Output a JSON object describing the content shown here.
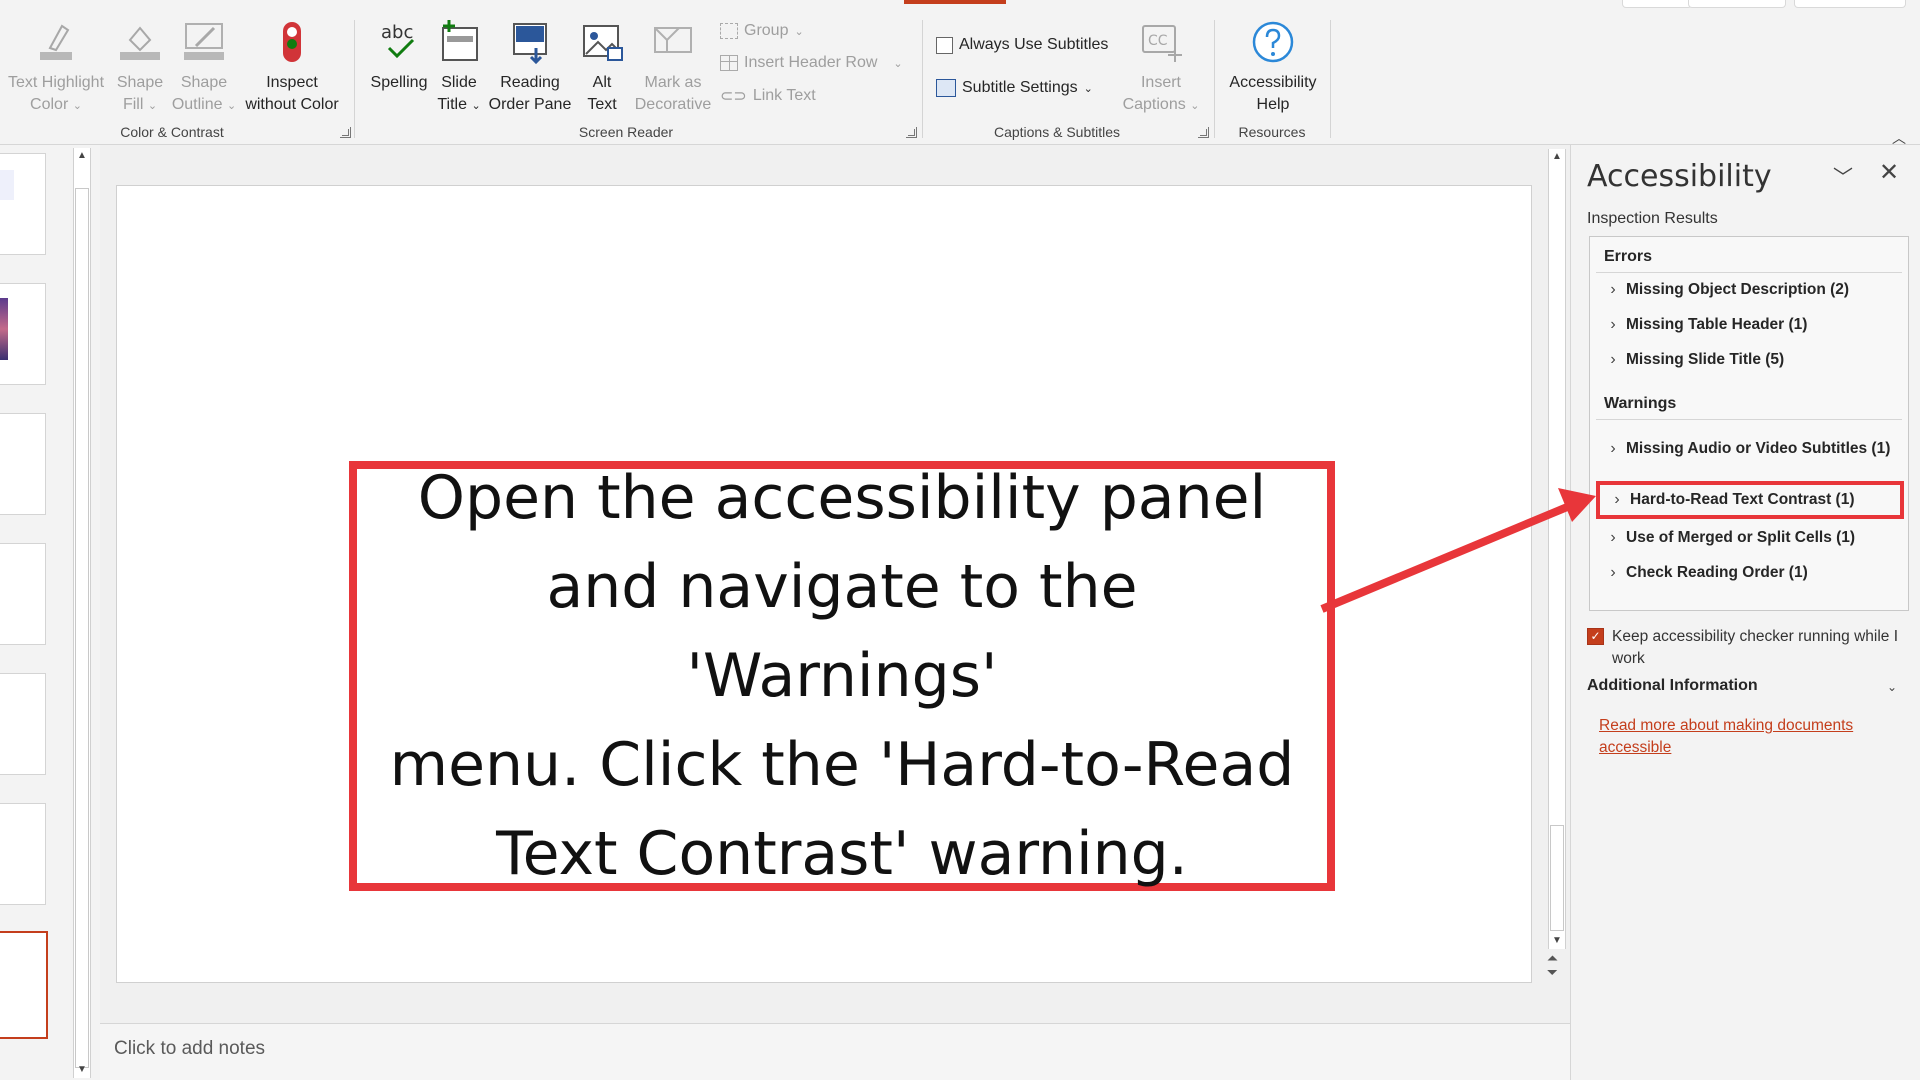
{
  "ribbon": {
    "groups": {
      "color_contrast": "Color & Contrast",
      "screen_reader": "Screen Reader",
      "captions": "Captions & Subtitles",
      "resources": "Resources"
    },
    "buttons": {
      "text_highlight": [
        "Text Highlight",
        "Color"
      ],
      "shape_fill": [
        "Shape",
        "Fill"
      ],
      "shape_outline": [
        "Shape",
        "Outline"
      ],
      "inspect": [
        "Inspect",
        "without Color"
      ],
      "spelling": [
        "Spelling"
      ],
      "slide_title": [
        "Slide",
        "Title"
      ],
      "reading_order": [
        "Reading",
        "Order Pane"
      ],
      "alt_text": [
        "Alt",
        "Text"
      ],
      "mark_decorative": [
        "Mark as",
        "Decorative"
      ],
      "insert_captions": [
        "Insert",
        "Captions"
      ],
      "accessibility_help": [
        "Accessibility",
        "Help"
      ]
    },
    "small": {
      "group": "Group",
      "insert_header_row": "Insert Header Row",
      "link_text": "Link Text",
      "always_use_subtitles": "Always Use Subtitles",
      "subtitle_settings": "Subtitle Settings"
    },
    "spelling_abc": "abc",
    "cc": "CC"
  },
  "notes": {
    "placeholder": "Click to add notes"
  },
  "callout": {
    "lines": [
      "Open the accessibility panel",
      "and navigate to the 'Warnings'",
      "menu. Click the 'Hard-to-Read",
      "Text Contrast' warning."
    ],
    "border_color": "#e8363a"
  },
  "accessibility": {
    "title": "Accessibility",
    "subtitle": "Inspection Results",
    "errors_label": "Errors",
    "errors": [
      "Missing Object Description (2)",
      "Missing Table Header (1)",
      "Missing Slide Title (5)"
    ],
    "warnings_label": "Warnings",
    "warnings": [
      "Missing Audio or Video Subtitles (1)",
      "Hard-to-Read Text Contrast (1)",
      "Use of Merged or Split Cells (1)",
      "Check Reading Order (1)"
    ],
    "keep_running": "Keep accessibility checker running while I work",
    "additional_info": "Additional Information",
    "read_more": "Read more about making documents accessible"
  },
  "colors": {
    "accent": "#c43e1c",
    "highlight": "#e8363a"
  }
}
